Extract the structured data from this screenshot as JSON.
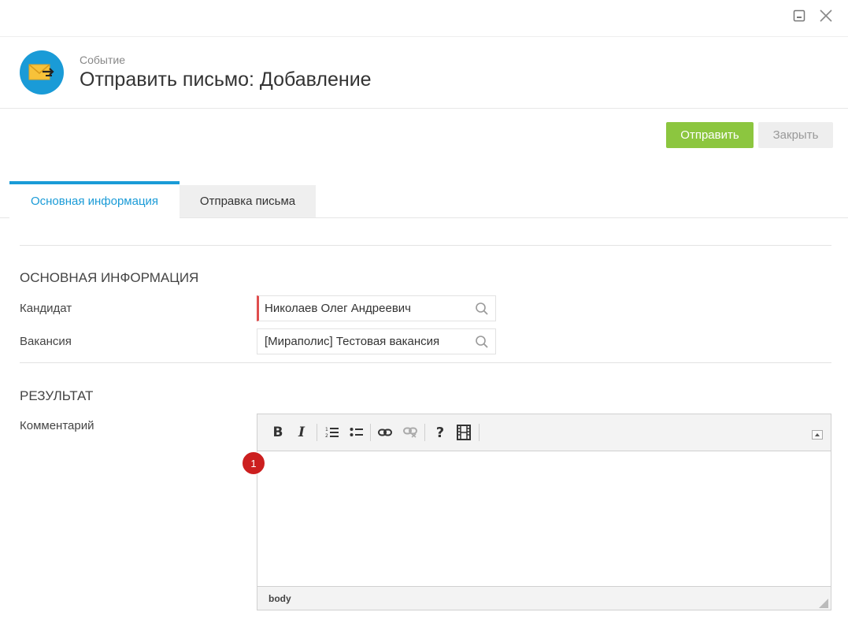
{
  "window": {
    "minimize_icon": "minimize-icon",
    "close_icon": "close-icon"
  },
  "header": {
    "icon": "envelope-send-icon",
    "subtitle": "Событие",
    "title": "Отправить письмо: Добавление"
  },
  "actions": {
    "send_label": "Отправить",
    "close_label": "Закрыть"
  },
  "tabs": [
    {
      "label": "Основная информация",
      "active": true
    },
    {
      "label": "Отправка письма",
      "active": false
    }
  ],
  "sections": {
    "main_info": {
      "title": "ОСНОВНАЯ ИНФОРМАЦИЯ",
      "candidate_label": "Кандидат",
      "candidate_value": "Николаев Олег Андреевич",
      "vacancy_label": "Вакансия",
      "vacancy_value": "[Мираполис] Тестовая вакансия"
    },
    "result": {
      "title": "РЕЗУЛЬТАТ",
      "comment_label": "Комментарий"
    }
  },
  "editor": {
    "toolbar": {
      "bold": "B",
      "italic": "I",
      "help": "?"
    },
    "status_path": "body",
    "content": ""
  },
  "badge": {
    "count": "1"
  },
  "colors": {
    "accent": "#1a9bd7",
    "send_button": "#8cc63f",
    "required_marker": "#e04e4e",
    "badge": "#cc1f1f"
  }
}
